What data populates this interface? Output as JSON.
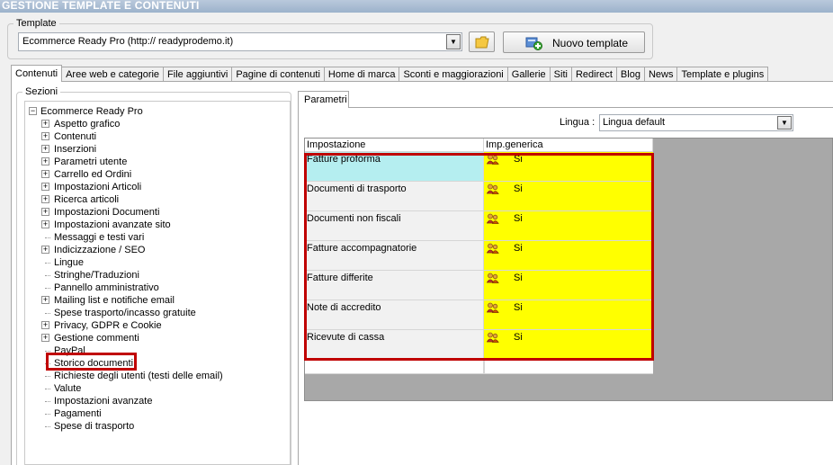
{
  "window": {
    "title": "GESTIONE TEMPLATE E CONTENUTI"
  },
  "template": {
    "legend": "Template",
    "selected_value": "Ecommerce Ready Pro (http://        readyprodemo.it)",
    "new_button_label": "Nuovo template"
  },
  "tabs": [
    "Contenuti",
    "Aree web e categorie",
    "File aggiuntivi",
    "Pagine di contenuti",
    "Home di marca",
    "Sconti e maggiorazioni",
    "Gallerie",
    "Siti",
    "Redirect",
    "Blog",
    "News",
    "Template e plugins"
  ],
  "active_tab": "Contenuti",
  "sections": {
    "legend": "Sezioni",
    "root": "Ecommerce Ready Pro",
    "items": [
      {
        "label": "Aspetto grafico",
        "expandable": true
      },
      {
        "label": "Contenuti",
        "expandable": true
      },
      {
        "label": "Inserzioni",
        "expandable": true
      },
      {
        "label": "Parametri utente",
        "expandable": true
      },
      {
        "label": "Carrello ed Ordini",
        "expandable": true
      },
      {
        "label": "Impostazioni Articoli",
        "expandable": true
      },
      {
        "label": "Ricerca articoli",
        "expandable": true
      },
      {
        "label": "Impostazioni Documenti",
        "expandable": true
      },
      {
        "label": "Impostazioni avanzate sito",
        "expandable": true
      },
      {
        "label": "Messaggi e testi vari",
        "expandable": false
      },
      {
        "label": "Indicizzazione / SEO",
        "expandable": true
      },
      {
        "label": "Lingue",
        "expandable": false
      },
      {
        "label": "Stringhe/Traduzioni",
        "expandable": false
      },
      {
        "label": "Pannello amministrativo",
        "expandable": false
      },
      {
        "label": "Mailing list e notifiche email",
        "expandable": true
      },
      {
        "label": "Spese trasporto/incasso gratuite",
        "expandable": false
      },
      {
        "label": "Privacy, GDPR e Cookie",
        "expandable": true
      },
      {
        "label": "Gestione commenti",
        "expandable": true
      },
      {
        "label": "PayPal",
        "expandable": false
      },
      {
        "label": "Storico documenti",
        "expandable": false,
        "selected": true
      },
      {
        "label": "Richieste degli utenti (testi delle email)",
        "expandable": false
      },
      {
        "label": "Valute",
        "expandable": false
      },
      {
        "label": "Impostazioni avanzate",
        "expandable": false
      },
      {
        "label": "Pagamenti",
        "expandable": false
      },
      {
        "label": "Spese di trasporto",
        "expandable": false
      }
    ]
  },
  "parametri": {
    "tab_label": "Parametri",
    "lingua_label": "Lingua :",
    "lingua_value": "Lingua default",
    "columns": [
      "Impostazione",
      "Imp.generica"
    ],
    "rows": [
      {
        "setting": "Fatture proforma",
        "value": "Si"
      },
      {
        "setting": "Documenti di trasporto",
        "value": "Si"
      },
      {
        "setting": "Documenti non fiscali",
        "value": "Si"
      },
      {
        "setting": "Fatture accompagnatorie",
        "value": "Si"
      },
      {
        "setting": "Fatture differite",
        "value": "Si"
      },
      {
        "setting": "Note di accredito",
        "value": "Si"
      },
      {
        "setting": "Ricevute di cassa",
        "value": "Si"
      }
    ]
  },
  "colors": {
    "value_cell": "#ffff00",
    "selected_row": "#b5eef0",
    "highlight_border": "#c00000"
  }
}
